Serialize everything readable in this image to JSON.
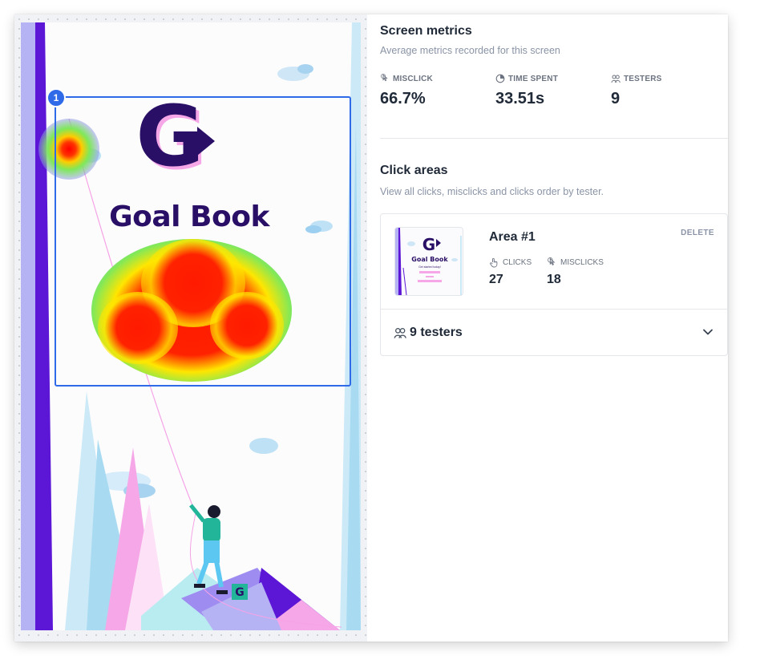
{
  "prototype": {
    "app_name": "Goal Book",
    "tagline": "Get started today!",
    "logo_letter": "G",
    "click_area_number": "1"
  },
  "metrics": {
    "title": "Screen metrics",
    "subtitle": "Average metrics recorded for this screen",
    "items": [
      {
        "label": "MISCLICK",
        "value": "66.7%",
        "icon": "misclick-icon"
      },
      {
        "label": "TIME SPENT",
        "value": "33.51s",
        "icon": "clock-icon"
      },
      {
        "label": "TESTERS",
        "value": "9",
        "icon": "people-icon"
      }
    ]
  },
  "click_areas": {
    "title": "Click areas",
    "subtitle": "View all clicks, misclicks and clicks order by tester.",
    "area": {
      "name": "Area #1",
      "delete_label": "DELETE",
      "clicks_label": "CLICKS",
      "clicks_value": "27",
      "misclicks_label": "MISCLICKS",
      "misclicks_value": "18",
      "testers_label": "9 testers",
      "thumbnail": {
        "app_name": "Goal Book",
        "tagline": "Get started today!",
        "logo_letter": "G"
      }
    }
  },
  "colors": {
    "accent_blue": "#2f6ae8",
    "brand_purple": "#2a0f67",
    "brand_violet": "#5b16d6",
    "brand_pink": "#f6a7e8"
  }
}
